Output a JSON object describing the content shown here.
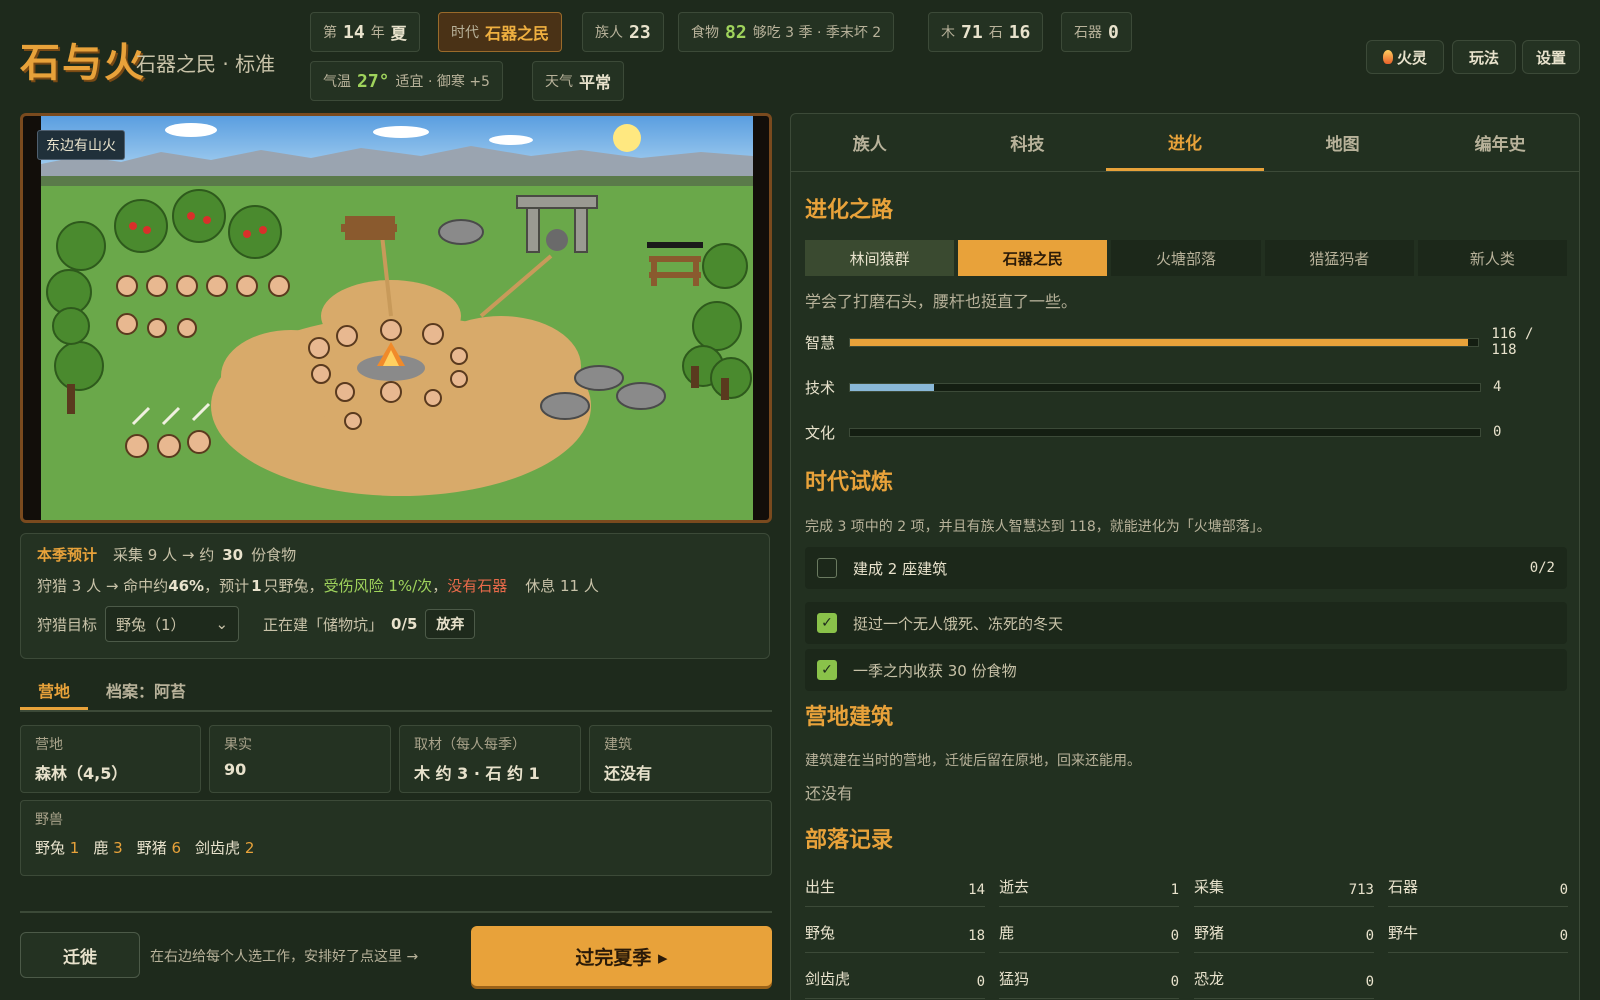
{
  "header": {
    "logo": "石与火",
    "subtitle": "石器之民 · 标准",
    "stats": {
      "year_prefix": "第",
      "year": "14",
      "year_unit": "年",
      "season": "夏",
      "era_label": "时代",
      "era": "石器之民",
      "pop_label": "族人",
      "pop": "23",
      "food_label": "食物",
      "food": "82",
      "food_note": "够吃 3 季 · 季末坏 2",
      "wood_label": "木",
      "wood": "71",
      "stone_label": "石",
      "stone": "16",
      "tools_label": "石器",
      "tools": "0",
      "temp_label": "气温",
      "temp": "27°",
      "temp_note": "适宜 · 御寒 +5",
      "weather_label": "天气",
      "weather": "平常"
    },
    "buttons": {
      "spirit": "火灵",
      "rules": "玩法",
      "settings": "设置"
    }
  },
  "scene": {
    "label": "东边有山火"
  },
  "forecast": {
    "title": "本季预计",
    "gather": "采集 9 人 → 约",
    "gather_val": "30",
    "gather_unit": "份食物",
    "hunt": "狩猎 3 人 → 命中约",
    "hit": "46%",
    "hunt_mid": "，预计",
    "hunt_n": "1",
    "hunt_tail": "只野兔，",
    "risk": "受伤风险 1%/次",
    "comma": "，",
    "no_tools": "没有石器",
    "rest": "休息 11 人",
    "target_label": "狩猎目标",
    "target_value": "野兔（1）",
    "building": "正在建「储物坑」",
    "building_progress": "0/5",
    "abandon": "放弃"
  },
  "left_tabs": [
    "营地",
    "档案：阿苔"
  ],
  "camp": {
    "cards": [
      {
        "k": "营地",
        "v": "森林（4,5）"
      },
      {
        "k": "果实",
        "v": "90"
      },
      {
        "k": "取材（每人每季）",
        "v": "木 约 3 · 石 约 1"
      },
      {
        "k": "建筑",
        "v": "还没有"
      }
    ],
    "beasts_label": "野兽",
    "beasts": [
      {
        "name": "野兔",
        "n": "1"
      },
      {
        "name": "鹿",
        "n": "3"
      },
      {
        "name": "野猪",
        "n": "6"
      },
      {
        "name": "剑齿虎",
        "n": "2"
      }
    ]
  },
  "footer": {
    "migrate": "迁徙",
    "hint": "在右边给每个人选工作，安排好了点这里 →",
    "advance": "过完夏季 ▸"
  },
  "right_tabs": [
    "族人",
    "科技",
    "进化",
    "地图",
    "编年史"
  ],
  "evolution": {
    "title": "进化之路",
    "path": [
      "林间猿群",
      "石器之民",
      "火塘部落",
      "猎猛犸者",
      "新人类"
    ],
    "current_index": 1,
    "desc": "学会了打磨石头，腰杆也挺直了一些。",
    "bars": [
      {
        "label": "智慧",
        "value": 116,
        "max": 118,
        "text": "116 / 118",
        "color": "#e8a23a"
      },
      {
        "label": "技术",
        "value": 4,
        "max": 30,
        "text": "4",
        "color": "#8ab8d8"
      },
      {
        "label": "文化",
        "value": 0,
        "max": 30,
        "text": "0",
        "color": "#8ab8d8"
      }
    ]
  },
  "trials": {
    "title": "时代试炼",
    "desc": "完成 3 项中的 2 项，并且有族人智慧达到 118，就能进化为「火塘部落」。",
    "items": [
      {
        "text": "建成 2 座建筑",
        "progress": "0/2",
        "done": false
      },
      {
        "text": "挺过一个无人饿死、冻死的冬天",
        "progress": "",
        "done": true
      },
      {
        "text": "一季之内收获 30 份食物",
        "progress": "",
        "done": true
      }
    ],
    "check_mark": "✓"
  },
  "buildings": {
    "title": "营地建筑",
    "desc": "建筑建在当时的营地，迁徙后留在原地，回来还能用。",
    "empty": "还没有"
  },
  "records": {
    "title": "部落记录",
    "items": [
      {
        "k": "出生",
        "v": "14"
      },
      {
        "k": "逝去",
        "v": "1"
      },
      {
        "k": "采集",
        "v": "713"
      },
      {
        "k": "石器",
        "v": "0"
      },
      {
        "k": "野兔",
        "v": "18"
      },
      {
        "k": "鹿",
        "v": "0"
      },
      {
        "k": "野猪",
        "v": "0"
      },
      {
        "k": "野牛",
        "v": "0"
      },
      {
        "k": "剑齿虎",
        "v": "0"
      },
      {
        "k": "猛犸",
        "v": "0"
      },
      {
        "k": "恐龙",
        "v": "0"
      }
    ]
  },
  "colors": {
    "accent": "#e8a23a",
    "bg": "#1e2a1c",
    "panel": "#243222",
    "check": "#8ac24a"
  }
}
